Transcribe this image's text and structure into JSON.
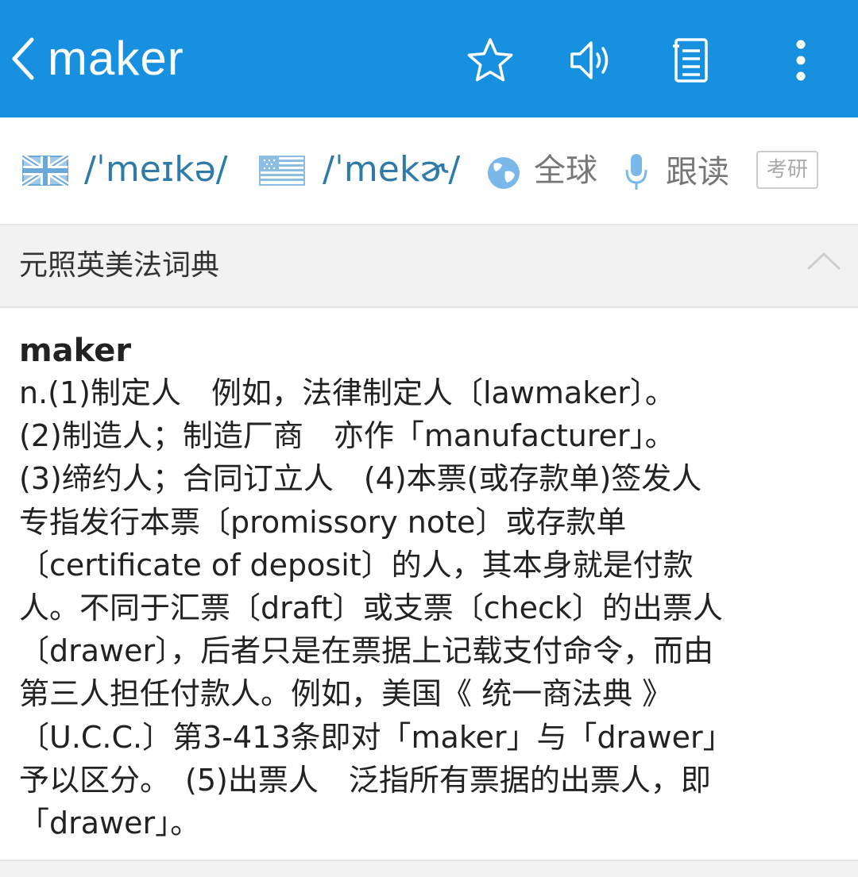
{
  "header": {
    "title": "maker",
    "background": "#1890e0"
  },
  "icons": {
    "back": "chevron-left-icon",
    "favorite": "star-icon",
    "speak": "speaker-icon",
    "notes": "notebook-icon",
    "more": "more-vertical-icon"
  },
  "pronunciation": {
    "uk": "/ˈmeɪkə/",
    "us": "/ˈmekɚ/",
    "global_label": "全球",
    "follow_label": "跟读",
    "exam_tag": "考研"
  },
  "dictionary": {
    "name": "元照英美法词典"
  },
  "entry": {
    "headword": "maker",
    "lines": [
      "n.(1)制定人　例如，法律制定人〔lawmaker〕。",
      "(2)制造人；制造厂商　亦作「manufacturer」。",
      "(3)缔约人；合同订立人　(4)本票(或存款单)签发人",
      "专指发行本票〔promissory note〕或存款单",
      "〔certificate of deposit〕的人，其本身就是付款",
      "人。不同于汇票〔draft〕或支票〔check〕的出票人",
      "〔drawer〕，后者只是在票据上记载支付命令，而由",
      "第三人担任付款人。例如，美国《 统一商法典 》",
      "〔U.C.C.〕第3-413条即对「maker」与「drawer」",
      "予以区分。　(5)出票人　泛指所有票据的出票人，即",
      "「drawer」。"
    ]
  }
}
